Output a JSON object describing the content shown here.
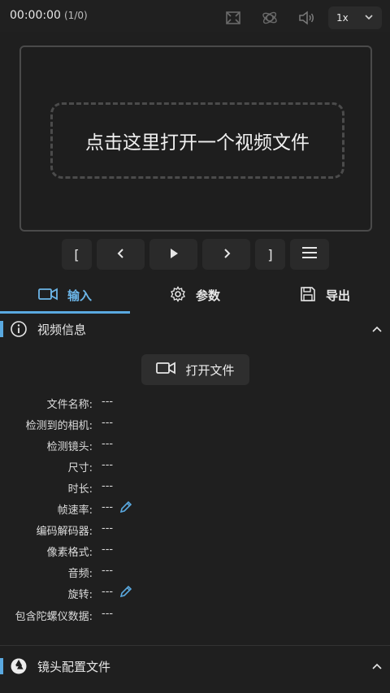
{
  "topbar": {
    "time": "00:00:00",
    "frames": "(1/0)",
    "speed": "1x",
    "icons": [
      "frame-icon",
      "gyro-icon",
      "volume-icon",
      "chevron-down-icon"
    ]
  },
  "preview": {
    "dropzone_text": "点击这里打开一个视频文件"
  },
  "controls": {
    "bracket_left": "[",
    "bracket_right": "]"
  },
  "tabs": [
    {
      "label": "输入",
      "icon": "video-camera-icon",
      "active": true
    },
    {
      "label": "参数",
      "icon": "gear-icon",
      "active": false
    },
    {
      "label": "导出",
      "icon": "save-icon",
      "active": false
    }
  ],
  "video_info": {
    "title": "视频信息",
    "open_button": "打开文件",
    "rows": [
      {
        "label": "文件名称:",
        "value": "---"
      },
      {
        "label": "检测到的相机:",
        "value": "---"
      },
      {
        "label": "检测镜头:",
        "value": "---"
      },
      {
        "label": "尺寸:",
        "value": "---"
      },
      {
        "label": "时长:",
        "value": "---"
      },
      {
        "label": "帧速率:",
        "value": "---"
      },
      {
        "label": "编码解码器:",
        "value": "---"
      },
      {
        "label": "像素格式:",
        "value": "---"
      },
      {
        "label": "音频:",
        "value": "---"
      },
      {
        "label": "旋转:",
        "value": "---"
      },
      {
        "label": "包含陀螺仪数据:",
        "value": "---"
      }
    ]
  },
  "lens_profile": {
    "title": "镜头配置文件"
  },
  "colors": {
    "accent": "#5aa9e0",
    "background": "#1f1f1f",
    "button": "#2a2a2a"
  }
}
